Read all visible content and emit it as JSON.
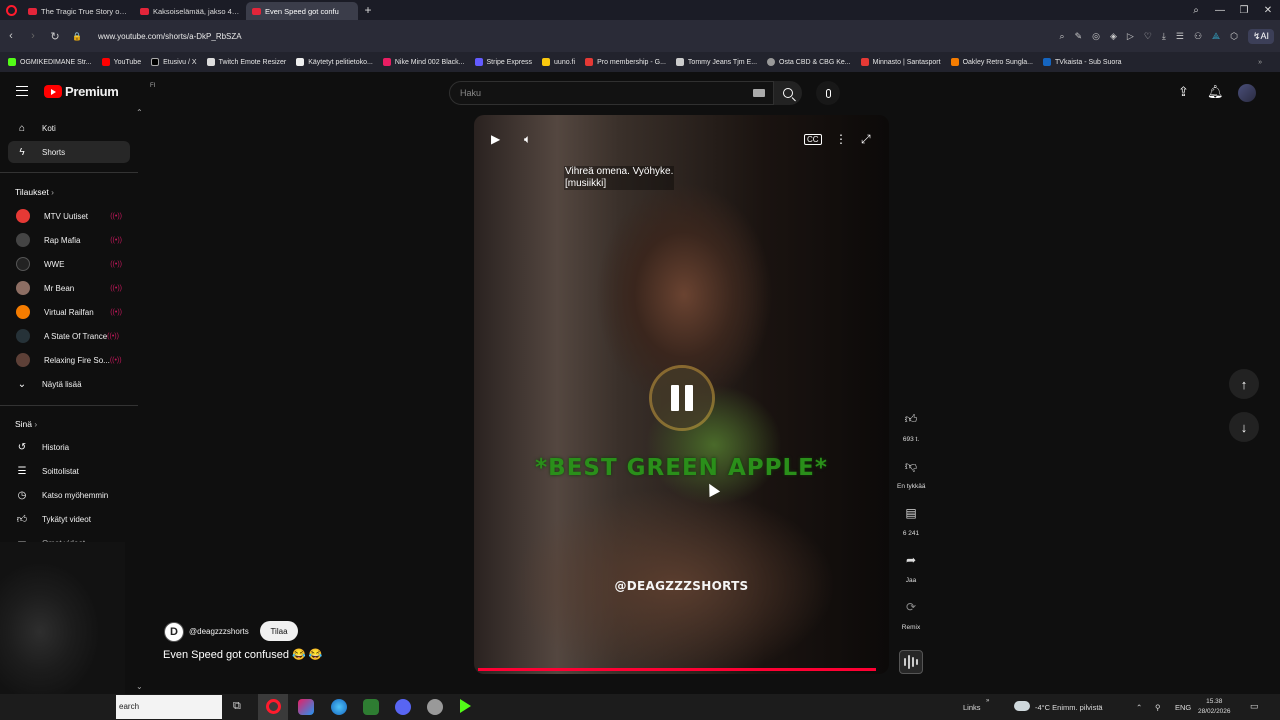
{
  "browser": {
    "tabs": [
      {
        "label": "The Tragic True Story of J...",
        "active": false
      },
      {
        "label": "Kaksoiselämää, jakso 4 - L",
        "active": false
      },
      {
        "label": "Even Speed got confu",
        "active": true
      }
    ],
    "url": "www.youtube.com/shorts/a-DkP_RbSZA",
    "ai_label": "AI",
    "bookmarks": [
      "OGMIKEDIMANE Str...",
      "YouTube",
      "Etusivu / X",
      "Twitch Emote Resizer",
      "Käytetyt pelitietoko...",
      "Nike Mind 002 Black...",
      "Stripe Express",
      "uuno.fi",
      "Pro membership - G...",
      "Tommy Jeans Tjm E...",
      "Osta CBD & CBG Ke...",
      "Minnasto | Santasport",
      "Oakley Retro Sungla...",
      "TVkaista - Sub Suora"
    ]
  },
  "youtube": {
    "logo_text": "Premium",
    "logo_sup": "FI",
    "search_placeholder": "Haku"
  },
  "sidebar": {
    "home": "Koti",
    "shorts": "Shorts",
    "subs_header": "Tilaukset",
    "subscriptions": [
      {
        "name": "MTV Uutiset",
        "color": "#e53935"
      },
      {
        "name": "Rap Mafia",
        "color": "#444444"
      },
      {
        "name": "WWE",
        "color": "#222222"
      },
      {
        "name": "Mr Bean",
        "color": "#8d6e63"
      },
      {
        "name": "Virtual Railfan",
        "color": "#f57c00"
      },
      {
        "name": "A State Of Trance",
        "color": "#263238"
      },
      {
        "name": "Relaxing Fire So...",
        "color": "#5d4037"
      }
    ],
    "show_more": "Näytä lisää",
    "you_header": "Sinä",
    "you_items": [
      "Historia",
      "Soittolistat",
      "Katso myöhemmin",
      "Tykätyt videot",
      "Omat videot"
    ]
  },
  "player": {
    "caption_line1": "Vihreä omena. Vyöhyke.",
    "caption_line2": "[musiikki]",
    "headline": "*BEST GREEN APPLE*",
    "handle_overlay": "@DEAGZZZSHORTS",
    "progress": 0.98
  },
  "actions": {
    "likes": "693 t.",
    "dislike": "En tykkää",
    "comments": "6 241",
    "share": "Jaa",
    "remix": "Remix"
  },
  "video": {
    "channel_initial": "D",
    "channel": "@deagzzzshorts",
    "subscribe": "Tilaa",
    "title": "Even Speed got confused 😂 😂"
  },
  "taskbar": {
    "search": "earch",
    "links": "Links",
    "weather": "-4°C  Enimm. pilvistä",
    "lang": "ENG",
    "time": "15.38",
    "date": "28/02/2026"
  }
}
